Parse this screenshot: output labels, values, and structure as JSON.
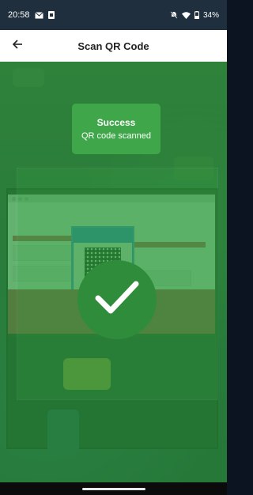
{
  "status_bar": {
    "time": "20:58",
    "battery": "34%",
    "icons": [
      "mail-icon",
      "sim-icon",
      "mute-icon",
      "wifi-icon",
      "battery-icon"
    ]
  },
  "app_bar": {
    "title": "Scan QR Code",
    "back_icon": "arrow-left-icon"
  },
  "scan_result": {
    "title": "Success",
    "message": "QR code scanned"
  },
  "colors": {
    "overlay_green": "#2f8c3b",
    "toast_green": "#3fa74a",
    "app_bar_bg": "#ffffff",
    "status_bar_bg": "#1f2f3e"
  }
}
